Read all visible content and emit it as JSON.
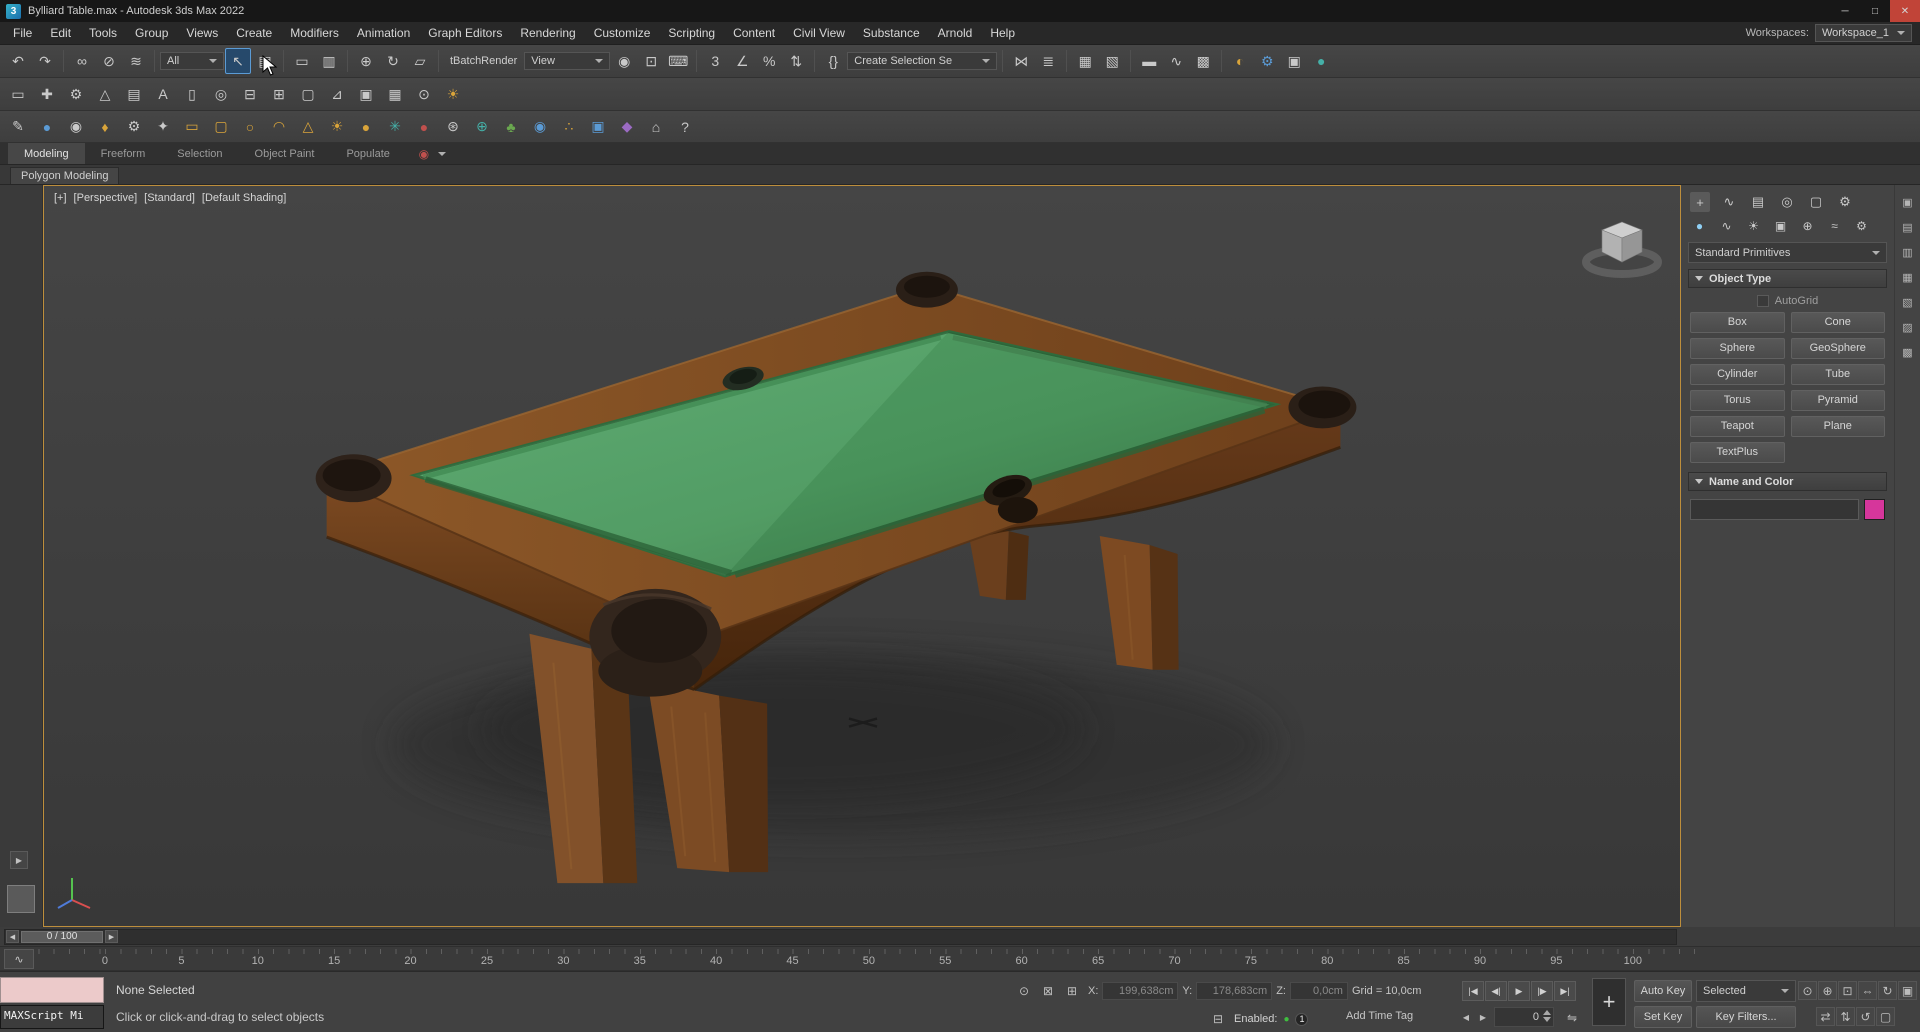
{
  "colors": {
    "accent_yellow": "#bd8e3c",
    "close_red": "#c14438",
    "swatch": "#d6369b",
    "status_green": "#3fbf3f",
    "felt": "#4c9a5f",
    "felt_dark": "#3c7a4a",
    "wood": "#835024",
    "wood_dark": "#5d3517",
    "pocket": "#2d211a",
    "viewport_bg": "#3f3f3f"
  },
  "titlebar": {
    "app_initial": "3",
    "title": "Bylliard Table.max - Autodesk 3ds Max 2022",
    "minimize": "─",
    "maximize": "□",
    "close": "✕"
  },
  "menubar": {
    "items": [
      {
        "n": "menu-file",
        "label": "File"
      },
      {
        "n": "menu-edit",
        "label": "Edit"
      },
      {
        "n": "menu-tools",
        "label": "Tools"
      },
      {
        "n": "menu-group",
        "label": "Group"
      },
      {
        "n": "menu-views",
        "label": "Views"
      },
      {
        "n": "menu-create",
        "label": "Create"
      },
      {
        "n": "menu-modifiers",
        "label": "Modifiers"
      },
      {
        "n": "menu-animation",
        "label": "Animation"
      },
      {
        "n": "menu-graph-editors",
        "label": "Graph Editors"
      },
      {
        "n": "menu-rendering",
        "label": "Rendering"
      },
      {
        "n": "menu-customize",
        "label": "Customize"
      },
      {
        "n": "menu-scripting",
        "label": "Scripting"
      },
      {
        "n": "menu-content",
        "label": "Content"
      },
      {
        "n": "menu-civil-view",
        "label": "Civil View"
      },
      {
        "n": "menu-substance",
        "label": "Substance"
      },
      {
        "n": "menu-arnold",
        "label": "Arnold"
      },
      {
        "n": "menu-help",
        "label": "Help"
      }
    ],
    "workspaces_label": "Workspaces:",
    "workspace": "Workspace_1"
  },
  "toolbar1": {
    "undo": "↶",
    "redo": "↷",
    "select_and_link": "∞",
    "unlink_selection": "⊘",
    "bind_to_space_warp": "≋",
    "selection_filter": "All",
    "select_object": "↖",
    "select_by_name": "▤",
    "selection_region": "▭",
    "window_crossing": "▥",
    "select_and_move": "⊕",
    "select_and_rotate": "↻",
    "select_and_scale": "▱",
    "batch_render_label": "tBatchRender",
    "reference_coordinate": "View",
    "use_pivot_center": "◉",
    "select_and_manipulate": "⊡",
    "keyboard_override": "⌨",
    "snaps_toggle": "3",
    "angle_snap": "∠",
    "percent_snap": "%",
    "spinner_snap": "⇅",
    "edit_named_sets": "{}",
    "named_sets": "Create Selection Se",
    "mirror": "⋈",
    "align": "≣",
    "scene_explorer": "▦",
    "layer_explorer": "▧",
    "ribbon_toggle": "▬",
    "curve_editor": "∿",
    "schematic_view": "▩",
    "material_editor": "◐",
    "render_setup": "⚙",
    "rendered_frame": "▣",
    "render_production": "●"
  },
  "toolbar2": {
    "icons": [
      {
        "n": "capsule-icon",
        "g": "▭"
      },
      {
        "n": "gizmo-icon",
        "g": "✚"
      },
      {
        "n": "gear-icon",
        "g": "⚙"
      },
      {
        "n": "terrain-icon",
        "g": "△"
      },
      {
        "n": "sheet-icon",
        "g": "▤"
      },
      {
        "n": "text-tool-icon",
        "g": "A"
      },
      {
        "n": "device-icon",
        "g": "▯"
      },
      {
        "n": "spiral-icon",
        "g": "◎"
      },
      {
        "n": "monitor-icon",
        "g": "⊟"
      },
      {
        "n": "grid-snap-icon",
        "g": "⊞"
      },
      {
        "n": "window-icon",
        "g": "▢"
      },
      {
        "n": "graph-icon",
        "g": "⊿"
      },
      {
        "n": "cubes-icon",
        "g": "▣"
      },
      {
        "n": "table-icon",
        "g": "▦"
      },
      {
        "n": "camera-icon",
        "g": "⊙"
      },
      {
        "n": "lightbulb-icon",
        "g": "☀",
        "c": "gold"
      }
    ]
  },
  "toolbar3": {
    "icons": [
      {
        "n": "paint-icon",
        "g": "✎"
      },
      {
        "n": "snow-globe-icon",
        "g": "●",
        "c": "blue"
      },
      {
        "n": "sample-icon",
        "g": "◉"
      },
      {
        "n": "key-icon",
        "g": "♦",
        "c": "gold"
      },
      {
        "n": "gears-icon",
        "g": "⚙"
      },
      {
        "n": "tools-icon",
        "g": "✦"
      },
      {
        "n": "rectangle-icon",
        "g": "▭",
        "c": "gold"
      },
      {
        "n": "rounded-rect-icon",
        "g": "▢",
        "c": "gold"
      },
      {
        "n": "circle-icon",
        "g": "○",
        "c": "gold"
      },
      {
        "n": "dome-icon",
        "g": "◠",
        "c": "gold"
      },
      {
        "n": "cone-icon",
        "g": "△",
        "c": "gold"
      },
      {
        "n": "sun-icon",
        "g": "☀",
        "c": "gold"
      },
      {
        "n": "sphere-icon",
        "g": "●",
        "c": "gold"
      },
      {
        "n": "snowflake-icon",
        "g": "✳",
        "c": "teal"
      },
      {
        "n": "red-ball-icon",
        "g": "●",
        "c": "red"
      },
      {
        "n": "atom-icon",
        "g": "⊛"
      },
      {
        "n": "globe-icon",
        "g": "⊕",
        "c": "teal"
      },
      {
        "n": "plant-icon",
        "g": "♣",
        "c": "green"
      },
      {
        "n": "marble-icon",
        "g": "◉",
        "c": "blue"
      },
      {
        "n": "dots-icon",
        "g": "∴",
        "c": "gold"
      },
      {
        "n": "photo-app-icon",
        "g": "▣",
        "c": "blue"
      },
      {
        "n": "substance-icon",
        "g": "◆",
        "c": "purple"
      },
      {
        "n": "building-icon",
        "g": "⌂"
      },
      {
        "n": "help-icon",
        "g": "?"
      }
    ]
  },
  "ribbon": {
    "tabs": [
      {
        "n": "tab-modeling",
        "label": "Modeling",
        "cls": "active"
      },
      {
        "n": "tab-freeform",
        "label": "Freeform"
      },
      {
        "n": "tab-selection",
        "label": "Selection"
      },
      {
        "n": "tab-object-paint",
        "label": "Object Paint"
      },
      {
        "n": "tab-populate",
        "label": "Populate"
      }
    ],
    "overflow_icon": "◉",
    "subtab": "Polygon Modeling"
  },
  "viewport": {
    "plus": "[+]",
    "view": "[Perspective]",
    "standard": "[Standard]",
    "shading": "[Default Shading]"
  },
  "panel": {
    "tabs": [
      {
        "n": "create-tab",
        "g": "+",
        "cls": "active"
      },
      {
        "n": "modify-tab",
        "g": "∿"
      },
      {
        "n": "hierarchy-tab",
        "g": "▤"
      },
      {
        "n": "motion-tab",
        "g": "◎"
      },
      {
        "n": "display-tab",
        "g": "▢"
      },
      {
        "n": "utilities-tab",
        "g": "⚙"
      }
    ],
    "categories": [
      {
        "n": "geometry-category-icon",
        "g": "●",
        "cls": "active"
      },
      {
        "n": "shapes-category-icon",
        "g": "∿"
      },
      {
        "n": "lights-category-icon",
        "g": "☀"
      },
      {
        "n": "cameras-category-icon",
        "g": "▣"
      },
      {
        "n": "helpers-category-icon",
        "g": "⊕"
      },
      {
        "n": "space-warps-category-icon",
        "g": "≈"
      },
      {
        "n": "systems-category-icon",
        "g": "⚙"
      }
    ],
    "dropdown": "Standard Primitives",
    "object_type_title": "Object Type",
    "autogrid_label": "AutoGrid",
    "buttons": [
      {
        "n": "box-button",
        "label": "Box"
      },
      {
        "n": "cone-button",
        "label": "Cone"
      },
      {
        "n": "sphere-button",
        "label": "Sphere"
      },
      {
        "n": "geosphere-button",
        "label": "GeoSphere"
      },
      {
        "n": "cylinder-button",
        "label": "Cylinder"
      },
      {
        "n": "tube-button",
        "label": "Tube"
      },
      {
        "n": "torus-button",
        "label": "Torus"
      },
      {
        "n": "pyramid-button",
        "label": "Pyramid"
      },
      {
        "n": "teapot-button",
        "label": "Teapot"
      },
      {
        "n": "plane-button",
        "label": "Plane"
      },
      {
        "n": "textplus-button",
        "label": "TextPlus"
      }
    ],
    "name_color_title": "Name and Color",
    "name_value": ""
  },
  "right_dock": {
    "icons": [
      {
        "n": "dock-viewport-icon",
        "g": "▣"
      },
      {
        "n": "dock-layers-icon",
        "g": "▤",
        "c": "gold"
      },
      {
        "n": "dock-lights-icon",
        "g": "▥"
      },
      {
        "n": "dock-render-icon",
        "g": "▦"
      },
      {
        "n": "dock-material-icon",
        "g": "▧"
      },
      {
        "n": "dock-history-icon",
        "g": "▨"
      },
      {
        "n": "dock-settings-icon",
        "g": "▩"
      }
    ]
  },
  "timeline": {
    "prev_arrow": "◀",
    "slider": "0 / 100",
    "next_arrow": "▶",
    "curve_editor_btn": "∿",
    "expand_arrow": "▶",
    "ruler": [
      "0",
      "5",
      "10",
      "15",
      "20",
      "25",
      "30",
      "35",
      "40",
      "45",
      "50",
      "55",
      "60",
      "65",
      "70",
      "75",
      "80",
      "85",
      "90",
      "95",
      "100"
    ]
  },
  "status": {
    "listener_label": "MAXScript Mi",
    "selection": "None Selected",
    "prompt": "Click or click-and-drag to select objects",
    "isolate_glyph": "⊙",
    "lock_glyph": "⊠",
    "abs_mode_glyph": "⊞",
    "x_label": "X:",
    "x": "199,638cm",
    "y_label": "Y:",
    "y": "178,683cm",
    "z_label": "Z:",
    "z": "0,0cm",
    "grid": "Grid = 10,0cm",
    "perf_glyph": "⊟",
    "enabled_label": "Enabled:",
    "enabled_dot": "●",
    "badge": "1",
    "add_time_tag": "Add Time Tag",
    "auto_key": "Auto Key",
    "set_key": "Set Key",
    "selected_dd": "Selected",
    "key_filters": "Key Filters...",
    "big_key": "+",
    "frame_value": "0",
    "key_mode": "⇋"
  },
  "playback": {
    "go_to_start": "|◀",
    "previous_frame": "◀|",
    "play": "▶",
    "next_frame": "|▶",
    "go_to_end": "▶|",
    "previous_key": "◀",
    "next_key": "▶"
  },
  "nav": {
    "row1": [
      {
        "n": "zoom-icon",
        "g": "⊙"
      },
      {
        "n": "zoom-all-icon",
        "g": "⊕"
      },
      {
        "n": "zoom-extents-icon",
        "g": "⊡"
      },
      {
        "n": "pan-view-icon",
        "g": "⇔"
      },
      {
        "n": "orbit-icon",
        "g": "↻"
      },
      {
        "n": "maximize-viewport-icon",
        "g": "▣"
      }
    ],
    "row2": [
      {
        "n": "pan-hand-icon",
        "g": "⇄"
      },
      {
        "n": "walk-through-icon",
        "g": "⇅"
      },
      {
        "n": "orbit-subobject-icon",
        "g": "↺"
      },
      {
        "n": "maximize-toggle-icon",
        "g": "▢"
      }
    ]
  }
}
